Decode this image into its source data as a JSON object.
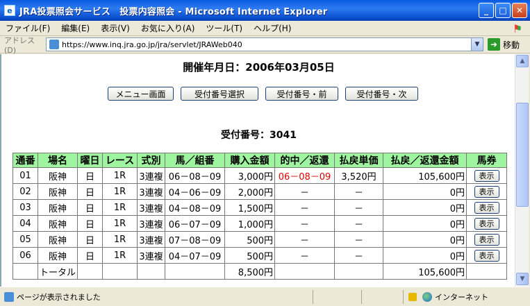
{
  "window": {
    "title": "JRA投票照会サービス　投票内容照会 - Microsoft Internet Explorer",
    "app_icon": "e",
    "minimize": "_",
    "maximize": "□",
    "close": "✕"
  },
  "menu": {
    "items": [
      "ファイル(F)",
      "編集(E)",
      "表示(V)",
      "お気に入り(A)",
      "ツール(T)",
      "ヘルプ(H)"
    ]
  },
  "address": {
    "label": "アドレス(D)",
    "url": "https://www.inq.jra.go.jp/jra/servlet/JRAWeb040",
    "go_label": "移動"
  },
  "page": {
    "date_line": "開催年月日：2006年03月05日",
    "buttons": [
      "メニュー画面",
      "受付番号選択",
      "受付番号・前",
      "受付番号・次"
    ],
    "receipt_line": "受付番号：3041"
  },
  "table": {
    "headers": [
      "通番",
      "場名",
      "曜日",
      "レース",
      "式別",
      "馬／組番",
      "購入金額",
      "的中／返還",
      "払戻単価",
      "払戻／返還金額",
      "馬券"
    ],
    "rows": [
      [
        "01",
        "阪神",
        "日",
        "1R",
        "3連複",
        "06－08－09",
        "3,000円",
        "06－08－09",
        "3,520円",
        "105,600円",
        "表示"
      ],
      [
        "02",
        "阪神",
        "日",
        "1R",
        "3連複",
        "04－06－09",
        "2,000円",
        "－",
        "－",
        "0円",
        "表示"
      ],
      [
        "03",
        "阪神",
        "日",
        "1R",
        "3連複",
        "04－08－09",
        "1,500円",
        "－",
        "－",
        "0円",
        "表示"
      ],
      [
        "04",
        "阪神",
        "日",
        "1R",
        "3連複",
        "06－07－09",
        "1,000円",
        "－",
        "－",
        "0円",
        "表示"
      ],
      [
        "05",
        "阪神",
        "日",
        "1R",
        "3連複",
        "07－08－09",
        "500円",
        "－",
        "－",
        "0円",
        "表示"
      ],
      [
        "06",
        "阪神",
        "日",
        "1R",
        "3連複",
        "04－07－09",
        "500円",
        "－",
        "－",
        "0円",
        "表示"
      ]
    ],
    "total_label": "トータル",
    "total_purchase": "8,500円",
    "total_payout": "105,600円"
  },
  "status": {
    "text": "ページが表示されました",
    "zone": "インターネット"
  },
  "colors": {
    "header_bg": "#9ff59f",
    "hit_text": "#dd0000",
    "titlebar": "#0a5ae0"
  }
}
